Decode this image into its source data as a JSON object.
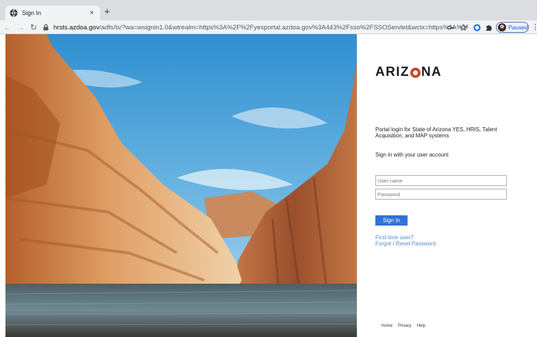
{
  "browser": {
    "tab_title": "Sign In",
    "tab_close": "×",
    "new_tab": "+",
    "url_host": "hrsts.azdoa.gov",
    "url_path": "/adfs/ls/?wa=wsignin1.0&wtrealm=https%3A%2F%2Fyesportal.azdoa.gov%3A443%2Fsso%2FSSOServlet&wctx=https%3A%2F%2Fyespo...",
    "profile_status": "Paused"
  },
  "login": {
    "logo_left": "ARIZ",
    "logo_right": "NA",
    "intro": "Portal login for State of Arizona YES, HRIS, Talent Acquisition, and MAP systems",
    "subhead": "Sign in with your user account",
    "username_placeholder": "User name",
    "password_placeholder": "Password",
    "signin_label": "Sign In",
    "first_time_link": "First-time user?",
    "forgot_link": "Forgot / Reset Password"
  },
  "footer": {
    "home": "Home",
    "privacy": "Privacy",
    "help": "Help"
  },
  "colors": {
    "brand_red": "#c8472c",
    "button_blue": "#2f73d8",
    "link_blue": "#4d8ec9"
  }
}
